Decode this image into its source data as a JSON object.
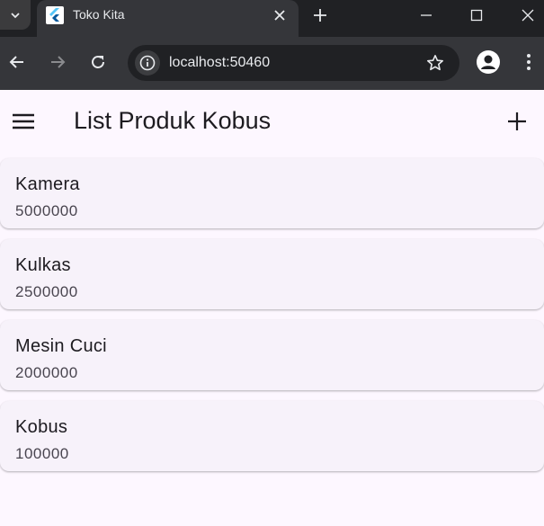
{
  "browser": {
    "tab_title": "Toko Kita",
    "url": "localhost:50460"
  },
  "appbar": {
    "title": "List Produk Kobus"
  },
  "products": [
    {
      "name": "Kamera",
      "price": "5000000"
    },
    {
      "name": "Kulkas",
      "price": "2500000"
    },
    {
      "name": "Mesin Cuci",
      "price": "2000000"
    },
    {
      "name": "Kobus",
      "price": "100000"
    }
  ],
  "colors": {
    "page_background": "#fdf7ff",
    "card_background": "#f7f2fa",
    "browser_frame": "#202124",
    "browser_toolbar": "#35363a"
  },
  "icons": [
    "chevron-down-icon",
    "flutter-icon",
    "close-icon",
    "plus-icon",
    "minimize-icon",
    "maximize-icon",
    "back-arrow-icon",
    "forward-arrow-icon",
    "reload-icon",
    "info-icon",
    "star-icon",
    "account-icon",
    "kebab-menu-icon",
    "hamburger-menu-icon",
    "add-icon"
  ]
}
